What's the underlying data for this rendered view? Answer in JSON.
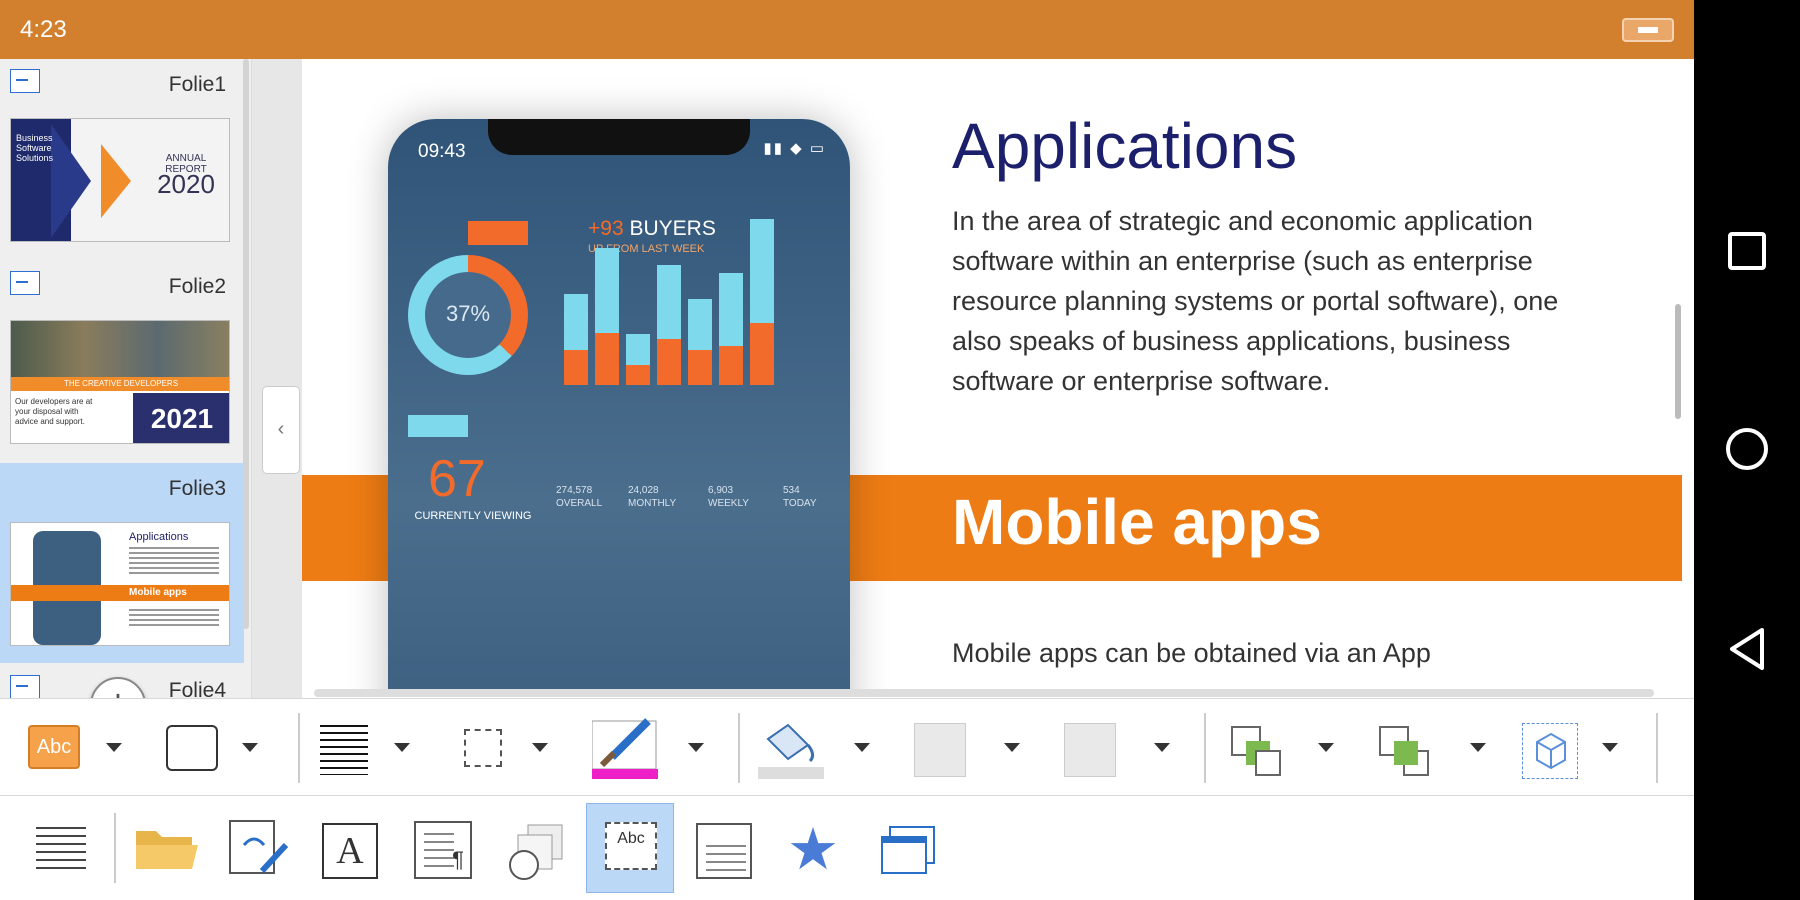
{
  "status_bar": {
    "time": "4:23"
  },
  "sidebar": {
    "slides": [
      {
        "name": "Folie1",
        "thumb": {
          "lines": [
            "Business",
            "Software",
            "Solutions"
          ],
          "subtitle": "ANNUAL REPORT",
          "year": "2020"
        }
      },
      {
        "name": "Folie2",
        "thumb": {
          "banner": "THE CREATIVE DEVELOPERS",
          "lines": [
            "Our developers are at",
            "your disposal with",
            "advice and support."
          ],
          "year": "2021"
        }
      },
      {
        "name": "Folie3",
        "selected": true,
        "thumb": {
          "title": "Applications",
          "band": "Mobile apps"
        }
      },
      {
        "name": "Folie4"
      }
    ],
    "add_label": "+",
    "collapse_label": "‹"
  },
  "slide": {
    "title": "Applications",
    "body": "In the area of strategic and economic application software within an enterprise (such as enterprise resource planning systems or portal software), one also speaks of business applications, business software or enterprise software.",
    "band_title": "Mobile apps",
    "body2": "Mobile apps can be obtained via an App",
    "phone": {
      "time": "09:43",
      "buyers_num": "+93",
      "buyers_label": "BUYERS",
      "week_label": "UP FROM LAST WEEK",
      "donut_pct": "37%",
      "donut_fraction": 0.37,
      "big_number": "67",
      "big_label": "CURRENTLY VIEWING",
      "stats": [
        {
          "value": "274,578",
          "label": "OVERALL"
        },
        {
          "value": "24,028",
          "label": "MONTHLY"
        },
        {
          "value": "6,903",
          "label": "WEEKLY"
        },
        {
          "value": "534",
          "label": "TODAY"
        }
      ],
      "bars": [
        {
          "top": 0.43,
          "bottom": 0.27
        },
        {
          "top": 0.65,
          "bottom": 0.4
        },
        {
          "top": 0.24,
          "bottom": 0.15
        },
        {
          "top": 0.57,
          "bottom": 0.35
        },
        {
          "top": 0.39,
          "bottom": 0.27
        },
        {
          "top": 0.56,
          "bottom": 0.3
        },
        {
          "top": 0.8,
          "bottom": 0.48
        }
      ]
    }
  },
  "toolbar1": {
    "items": [
      "text-style-button",
      "shape-border-button",
      "line-style-button",
      "shadow-button",
      "line-color-button",
      "fill-color-button",
      "align-left-button",
      "align-center-button",
      "bring-forward-button",
      "send-backward-button",
      "3d-button"
    ],
    "text_style_label": "Abc"
  },
  "toolbar2": {
    "items": [
      "menu-button",
      "open-file-button",
      "clipboard-button",
      "insert-text-button",
      "paragraph-button",
      "shapes-button",
      "textbox-button",
      "layout-button",
      "favorites-button",
      "windows-button"
    ],
    "textbox_label": "Abc",
    "text_label": "A"
  },
  "colors": {
    "accent": "#d3802e",
    "band": "#ee7c14",
    "title": "#1c1f6c",
    "selection": "#bcd8f7"
  }
}
